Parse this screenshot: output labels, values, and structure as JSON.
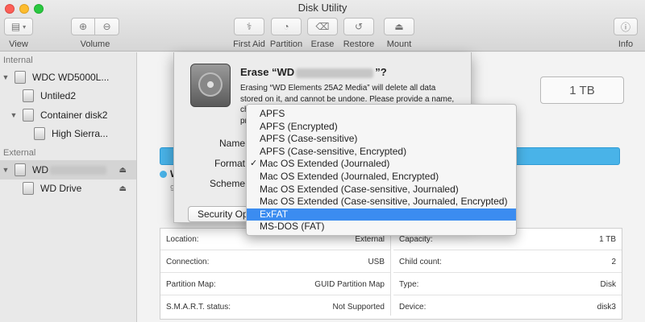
{
  "window": {
    "title": "Disk Utility"
  },
  "toolbar": {
    "view_label": "View",
    "volume_label": "Volume",
    "first_aid_label": "First Aid",
    "partition_label": "Partition",
    "erase_label": "Erase",
    "restore_label": "Restore",
    "mount_label": "Mount",
    "info_label": "Info"
  },
  "sidebar": {
    "internal_header": "Internal",
    "external_header": "External",
    "items": [
      {
        "label": "WDC WD5000L..."
      },
      {
        "label": "Untiled2"
      },
      {
        "label": "Container disk2"
      },
      {
        "label": "High Sierra..."
      },
      {
        "label": "WD"
      },
      {
        "label": "WD Drive"
      }
    ]
  },
  "main": {
    "capacity_box": "1 TB",
    "legend_fragment": "W",
    "legend_sub_fragment": "9",
    "info_left": [
      {
        "label": "Location:",
        "value": "External"
      },
      {
        "label": "Connection:",
        "value": "USB"
      },
      {
        "label": "Partition Map:",
        "value": "GUID Partition Map"
      },
      {
        "label": "S.M.A.R.T. status:",
        "value": "Not Supported"
      }
    ],
    "info_right": [
      {
        "label": "Capacity:",
        "value": "1 TB"
      },
      {
        "label": "Child count:",
        "value": "2"
      },
      {
        "label": "Type:",
        "value": "Disk"
      },
      {
        "label": "Device:",
        "value": "disk3"
      }
    ]
  },
  "dialog": {
    "title_prefix": "Erase “WD",
    "title_suffix": "”?",
    "body_line1": "Erasing “WD Elements 25A2 Media” will delete all data",
    "body_line2": "stored on it, and cannot be undone. Please provide a name,",
    "body_fragment_3": "ch",
    "body_fragment_4": "pr",
    "name_label": "Name",
    "format_label": "Format",
    "scheme_label": "Scheme",
    "security_button": "Security Options..."
  },
  "format_menu": {
    "checked_index": 4,
    "highlighted_index": 8,
    "check_glyph": "✓",
    "options": [
      "APFS",
      "APFS (Encrypted)",
      "APFS (Case-sensitive)",
      "APFS (Case-sensitive, Encrypted)",
      "Mac OS Extended (Journaled)",
      "Mac OS Extended (Journaled, Encrypted)",
      "Mac OS Extended (Case-sensitive, Journaled)",
      "Mac OS Extended (Case-sensitive, Journaled, Encrypted)",
      "ExFAT",
      "MS-DOS (FAT)"
    ]
  },
  "colors": {
    "accent": "#3b8cf0",
    "bar": "#49b3e8"
  }
}
